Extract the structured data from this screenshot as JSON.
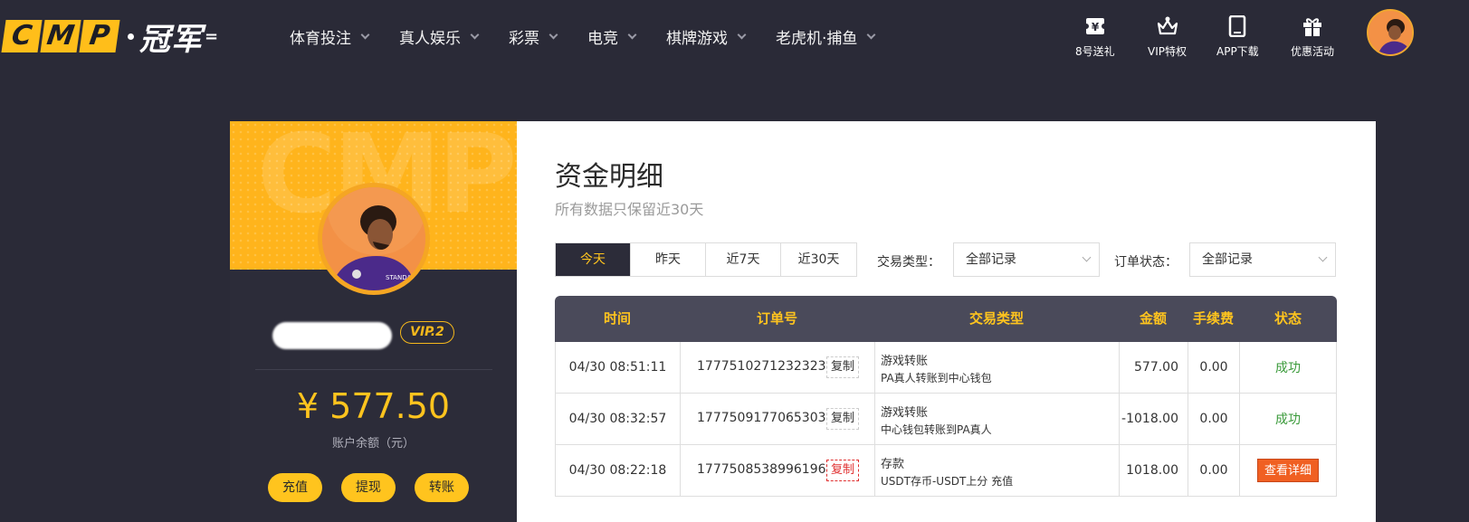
{
  "brand": {
    "logo_letters": [
      "C",
      "M",
      "P"
    ],
    "logo_cn": "冠军",
    "accent_color": "#ffc41e"
  },
  "nav": {
    "items": [
      {
        "label": "体育投注"
      },
      {
        "label": "真人娱乐"
      },
      {
        "label": "彩票"
      },
      {
        "label": "电竞"
      },
      {
        "label": "棋牌游戏"
      },
      {
        "label": "老虎机·捕鱼"
      }
    ]
  },
  "quick_links": [
    {
      "label": "8号送礼",
      "icon": "yen-ticket-icon"
    },
    {
      "label": "VIP特权",
      "icon": "crown-icon"
    },
    {
      "label": "APP下载",
      "icon": "phone-icon"
    },
    {
      "label": "优惠活动",
      "icon": "gift-icon"
    }
  ],
  "profile": {
    "watermark": "CMP",
    "vip_level": "VIP.2",
    "balance": "¥ 577.50",
    "balance_label": "账户余额（元）",
    "actions": [
      {
        "label": "充值"
      },
      {
        "label": "提现"
      },
      {
        "label": "转账"
      }
    ]
  },
  "main": {
    "title": "资金明细",
    "subtitle": "所有数据只保留近30天",
    "range_tabs": [
      {
        "label": "今天",
        "active": true
      },
      {
        "label": "昨天",
        "active": false
      },
      {
        "label": "近7天",
        "active": false
      },
      {
        "label": "近30天",
        "active": false
      }
    ],
    "filters": {
      "type_label": "交易类型：",
      "type_value": "全部记录",
      "status_label": "订单状态：",
      "status_value": "全部记录"
    },
    "table": {
      "headers": [
        "时间",
        "订单号",
        "交易类型",
        "金额",
        "手续费",
        "状态"
      ],
      "rows": [
        {
          "time": "04/30 08:51:11",
          "order": "1777510271232323",
          "copy": "复制",
          "type_main": "游戏转账",
          "type_sub": "PA真人转账到中心钱包",
          "amount": "577.00",
          "fee": "0.00",
          "status": "成功"
        },
        {
          "time": "04/30 08:32:57",
          "order": "1777509177065303",
          "copy": "复制",
          "type_main": "游戏转账",
          "type_sub": "中心钱包转账到PA真人",
          "amount": "-1018.00",
          "fee": "0.00",
          "status": "成功"
        },
        {
          "time": "04/30 08:22:18",
          "order": "1777508538996196",
          "copy": "复制",
          "type_main": "存款",
          "type_sub": "USDT存币-USDT上分 充值",
          "amount": "1018.00",
          "fee": "0.00",
          "status": "查看详细"
        }
      ]
    }
  }
}
